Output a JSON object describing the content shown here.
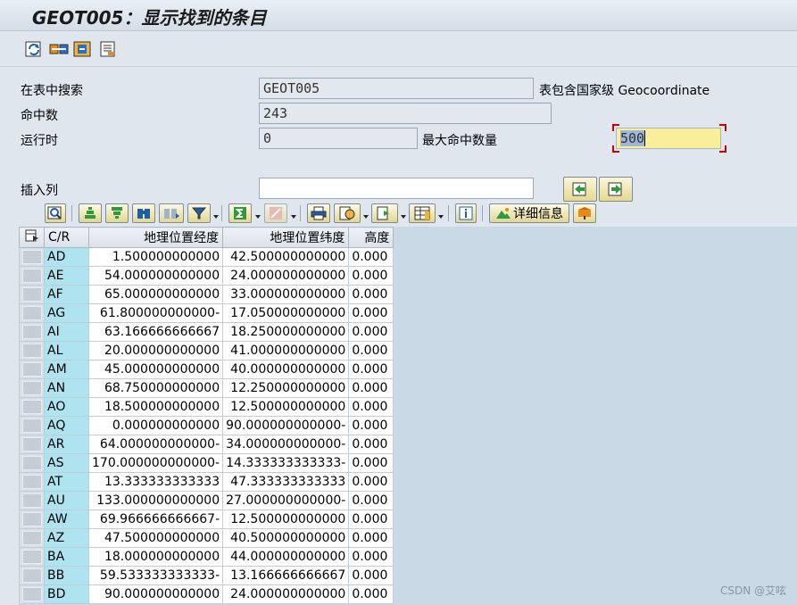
{
  "window": {
    "title": "GEOT005：显示找到的条目"
  },
  "toolbar_icons": [
    "refresh-icon",
    "field-selection-icon",
    "settings-icon",
    "list-icon"
  ],
  "form": {
    "search_in_table_label": "在表中搜索",
    "table_name": "GEOT005",
    "table_description": "表包含国家级 Geocoordinate",
    "hits_label": "命中数",
    "hits_value": "243",
    "runtime_label": "运行时",
    "runtime_value": "0",
    "max_hits_label": "最大命中数量",
    "max_hits_value": "500",
    "insert_column_label": "插入列",
    "insert_column_value": ""
  },
  "alv_toolbar": {
    "detail_info_label": "详细信息"
  },
  "table": {
    "columns": [
      "C/R",
      "地理位置经度",
      "地理位置纬度",
      "高度"
    ],
    "rows": [
      [
        "AD",
        "1.500000000000",
        "42.500000000000",
        "0.000"
      ],
      [
        "AE",
        "54.000000000000",
        "24.000000000000",
        "0.000"
      ],
      [
        "AF",
        "65.000000000000",
        "33.000000000000",
        "0.000"
      ],
      [
        "AG",
        "61.800000000000-",
        "17.050000000000",
        "0.000"
      ],
      [
        "AI",
        "63.166666666667",
        "18.250000000000",
        "0.000"
      ],
      [
        "AL",
        "20.000000000000",
        "41.000000000000",
        "0.000"
      ],
      [
        "AM",
        "45.000000000000",
        "40.000000000000",
        "0.000"
      ],
      [
        "AN",
        "68.750000000000",
        "12.250000000000",
        "0.000"
      ],
      [
        "AO",
        "18.500000000000",
        "12.500000000000",
        "0.000"
      ],
      [
        "AQ",
        "0.000000000000",
        "90.000000000000-",
        "0.000"
      ],
      [
        "AR",
        "64.000000000000-",
        "34.000000000000-",
        "0.000"
      ],
      [
        "AS",
        "170.000000000000-",
        "14.333333333333-",
        "0.000"
      ],
      [
        "AT",
        "13.333333333333",
        "47.333333333333",
        "0.000"
      ],
      [
        "AU",
        "133.000000000000",
        "27.000000000000-",
        "0.000"
      ],
      [
        "AW",
        "69.966666666667-",
        "12.500000000000",
        "0.000"
      ],
      [
        "AZ",
        "47.500000000000",
        "40.500000000000",
        "0.000"
      ],
      [
        "BA",
        "18.000000000000",
        "44.000000000000",
        "0.000"
      ],
      [
        "BB",
        "59.533333333333-",
        "13.166666666667",
        "0.000"
      ],
      [
        "BD",
        "90.000000000000",
        "24.000000000000",
        "0.000"
      ]
    ]
  },
  "watermark": "CSDN @艾呟"
}
